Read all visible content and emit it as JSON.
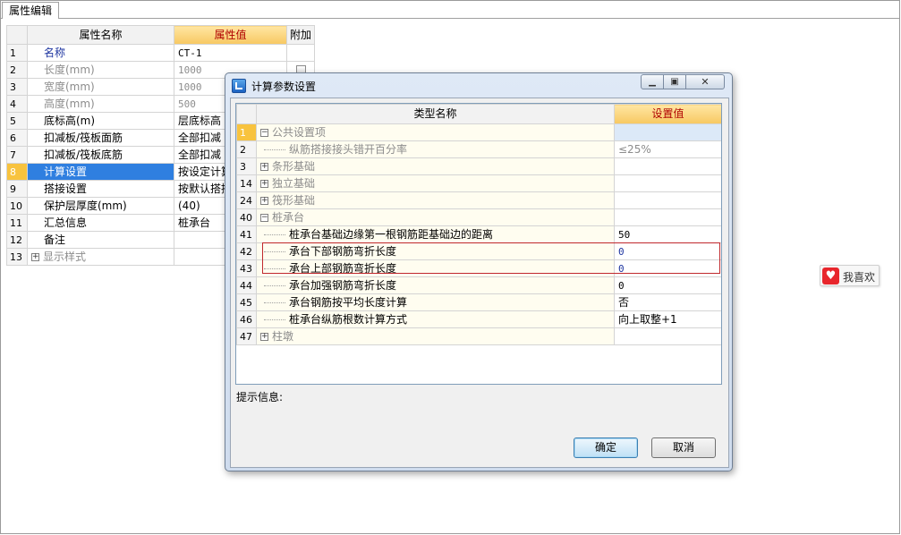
{
  "app": {
    "tab_label": "属性编辑"
  },
  "property_grid": {
    "headers": {
      "name": "属性名称",
      "value": "属性值",
      "extra": "附加"
    },
    "rows": [
      {
        "idx": "1",
        "name": "名称",
        "value": "CT-1",
        "style": "blue"
      },
      {
        "idx": "2",
        "name": "长度(mm)",
        "value": "1000",
        "style": "gray"
      },
      {
        "idx": "3",
        "name": "宽度(mm)",
        "value": "1000",
        "style": "gray"
      },
      {
        "idx": "4",
        "name": "高度(mm)",
        "value": "500",
        "style": "gray"
      },
      {
        "idx": "5",
        "name": "底标高(m)",
        "value": "层底标高",
        "style": "normal"
      },
      {
        "idx": "6",
        "name": "扣减板/筏板面筋",
        "value": "全部扣减",
        "style": "normal"
      },
      {
        "idx": "7",
        "name": "扣减板/筏板底筋",
        "value": "全部扣减",
        "style": "normal"
      },
      {
        "idx": "8",
        "name": "计算设置",
        "value": "按设定计算",
        "style": "selected"
      },
      {
        "idx": "9",
        "name": "搭接设置",
        "value": "按默认搭接",
        "style": "normal"
      },
      {
        "idx": "10",
        "name": "保护层厚度(mm)",
        "value": "(40)",
        "style": "normal"
      },
      {
        "idx": "11",
        "name": "汇总信息",
        "value": "桩承台",
        "style": "normal"
      },
      {
        "idx": "12",
        "name": "备注",
        "value": "",
        "style": "normal"
      },
      {
        "idx": "13",
        "name": "显示样式",
        "value": "",
        "style": "gray"
      }
    ]
  },
  "like_badge": {
    "label": "我喜欢",
    "icon": "heart-icon",
    "color": "#e8262c"
  },
  "dialog": {
    "title": "计算参数设置",
    "headers": {
      "name": "类型名称",
      "value": "设置值"
    },
    "rows": [
      {
        "idx": "1",
        "name": "公共设置项",
        "value": ""
      },
      {
        "idx": "2",
        "name": "纵筋搭接接头错开百分率",
        "value": "≤25%"
      },
      {
        "idx": "3",
        "name": "条形基础",
        "value": ""
      },
      {
        "idx": "14",
        "name": "独立基础",
        "value": ""
      },
      {
        "idx": "24",
        "name": "筏形基础",
        "value": ""
      },
      {
        "idx": "40",
        "name": "桩承台",
        "value": ""
      },
      {
        "idx": "41",
        "name": "桩承台基础边缘第一根钢筋距基础边的距离",
        "value": "50"
      },
      {
        "idx": "42",
        "name": "承台下部钢筋弯折长度",
        "value": "0"
      },
      {
        "idx": "43",
        "name": "承台上部钢筋弯折长度",
        "value": "0"
      },
      {
        "idx": "44",
        "name": "承台加强钢筋弯折长度",
        "value": "0"
      },
      {
        "idx": "45",
        "name": "承台钢筋按平均长度计算",
        "value": "否"
      },
      {
        "idx": "46",
        "name": "桩承台纵筋根数计算方式",
        "value": "向上取整+1"
      },
      {
        "idx": "47",
        "name": "柱墩",
        "value": ""
      }
    ],
    "hint_label": "提示信息:",
    "ok_label": "确定",
    "cancel_label": "取消"
  },
  "colors": {
    "header_gold": "#f7c862",
    "selection_blue": "#2f7fe0",
    "highlight_red": "#c0282d"
  }
}
